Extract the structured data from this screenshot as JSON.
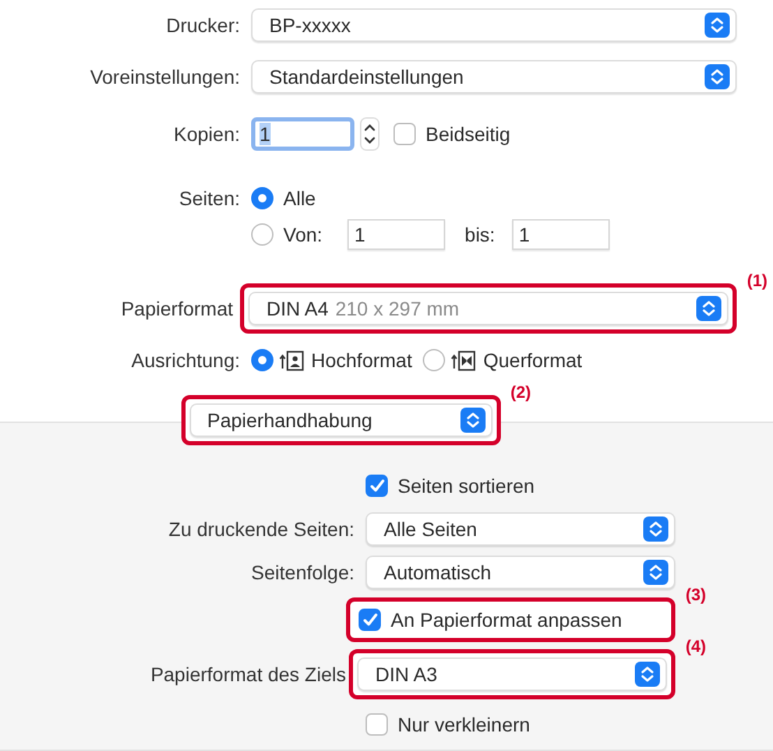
{
  "printer": {
    "label": "Drucker:",
    "value": "BP-xxxxx"
  },
  "presets": {
    "label": "Voreinstellungen:",
    "value": "Standardeinstellungen"
  },
  "copies": {
    "label": "Kopien:",
    "value": "1",
    "duplex": {
      "label": "Beidseitig",
      "checked": false
    }
  },
  "pages": {
    "label": "Seiten:",
    "options": [
      {
        "label": "Alle",
        "selected": true
      },
      {
        "label": "Von:",
        "selected": false
      }
    ],
    "from": "1",
    "to_label": "bis:",
    "to": "1"
  },
  "paper_size": {
    "label": "Papierformat",
    "value": "DIN A4",
    "detail": "210 x 297 mm",
    "callout": "(1)"
  },
  "orientation": {
    "label": "Ausrichtung:",
    "options": [
      {
        "label": "Hochformat",
        "selected": true
      },
      {
        "label": "Querformat",
        "selected": false
      }
    ]
  },
  "section_menu": {
    "value": "Papierhandhabung",
    "callout": "(2)"
  },
  "paper_handling": {
    "rows": [
      {
        "kind": "checkbox",
        "label": "Seiten sortieren",
        "checked": true
      },
      {
        "kind": "popup",
        "label": "Zu druckende Seiten:",
        "value": "Alle Seiten"
      },
      {
        "kind": "popup",
        "label": "Seitenfolge:",
        "value": "Automatisch"
      },
      {
        "kind": "checkbox",
        "label": "An Papierformat anpassen",
        "checked": true,
        "callout": "(3)"
      },
      {
        "kind": "popup",
        "label": "Papierformat des Ziels",
        "value": "DIN A3",
        "callout": "(4)"
      },
      {
        "kind": "checkbox",
        "label": "Nur verkleinern",
        "checked": false
      }
    ]
  }
}
